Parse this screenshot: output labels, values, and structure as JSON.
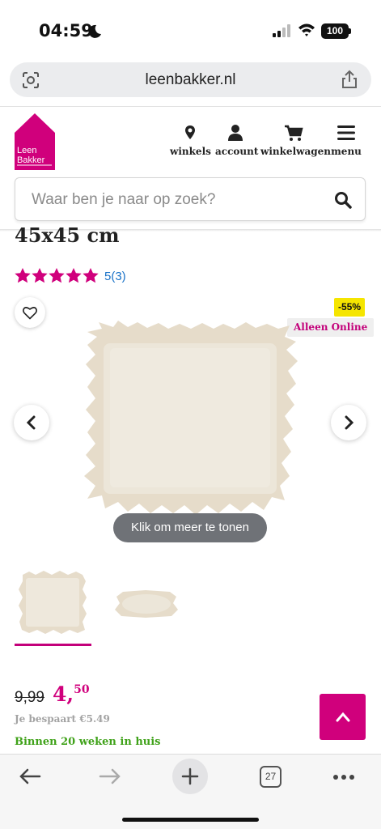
{
  "status_bar": {
    "time": "04:59",
    "battery": "100"
  },
  "browser": {
    "url": "leenbakker.nl"
  },
  "header": {
    "logo": {
      "line1": "Leen",
      "line2": "Bakker"
    },
    "nav": [
      {
        "label": "winkels",
        "icon": "location-pin-icon"
      },
      {
        "label": "account",
        "icon": "user-icon"
      },
      {
        "label": "winkelwagen",
        "icon": "cart-icon"
      },
      {
        "label": "menu",
        "icon": "hamburger-icon"
      }
    ],
    "search": {
      "placeholder": "Waar ben je naar op zoek?"
    }
  },
  "product": {
    "title_partial": "45x45 cm",
    "rating": {
      "stars": 5,
      "text": "5(3)"
    },
    "badges": {
      "discount": "-55%",
      "online": "Alleen Online"
    },
    "more_button": "Klik om meer te tonen",
    "price": {
      "old": "9,99",
      "new_int": "4,",
      "new_dec": "50",
      "savings": "Je bespaart €5.49"
    },
    "delivery": "Binnen 20 weken in huis"
  },
  "toolbar": {
    "tab_count": "27"
  },
  "colors": {
    "brand": "#d0007c",
    "discount_badge": "#f5e500",
    "delivery_green": "#40a21a",
    "rating_link": "#1a73c8"
  }
}
